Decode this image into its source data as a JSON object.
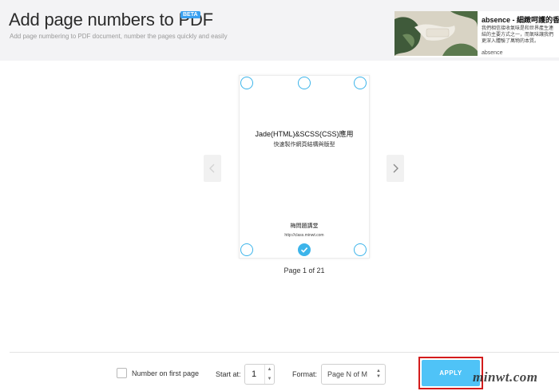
{
  "header": {
    "title": "Add page numbers to PDF",
    "badge": "BETA",
    "subtitle": "Add page numbering to PDF document, number the pages quickly and easily"
  },
  "ad": {
    "title": "absence - 細緻呵護的香氛",
    "body": "我們相信接收氣味是和世界產生連結的主要方式之一，而氣味讓我們更深入體驗了萬物的本質。",
    "brand": "absence"
  },
  "viewer": {
    "prev_icon": "chevron-left-icon",
    "next_icon": "chevron-right-icon",
    "doc": {
      "title": "Jade(HTML)&SCSS(CSS)應用",
      "subtitle": "快速製作網頁結構與版型",
      "author": "梅問題講堂",
      "url": "http://class.minwt.com"
    },
    "selected_position": "bottom-center",
    "page_label": "Page 1 of 21"
  },
  "controls": {
    "first_page_label": "Number on first page",
    "first_page_checked": false,
    "start_label": "Start at:",
    "start_value": "1",
    "format_label": "Format:",
    "format_value": "Page N of M",
    "apply_label": "APPLY"
  },
  "watermark": "minwt.com",
  "colors": {
    "accent": "#3cb4ea",
    "apply": "#4fc3f7",
    "highlight": "#d31c1c",
    "badge": "#3aa0f0"
  }
}
